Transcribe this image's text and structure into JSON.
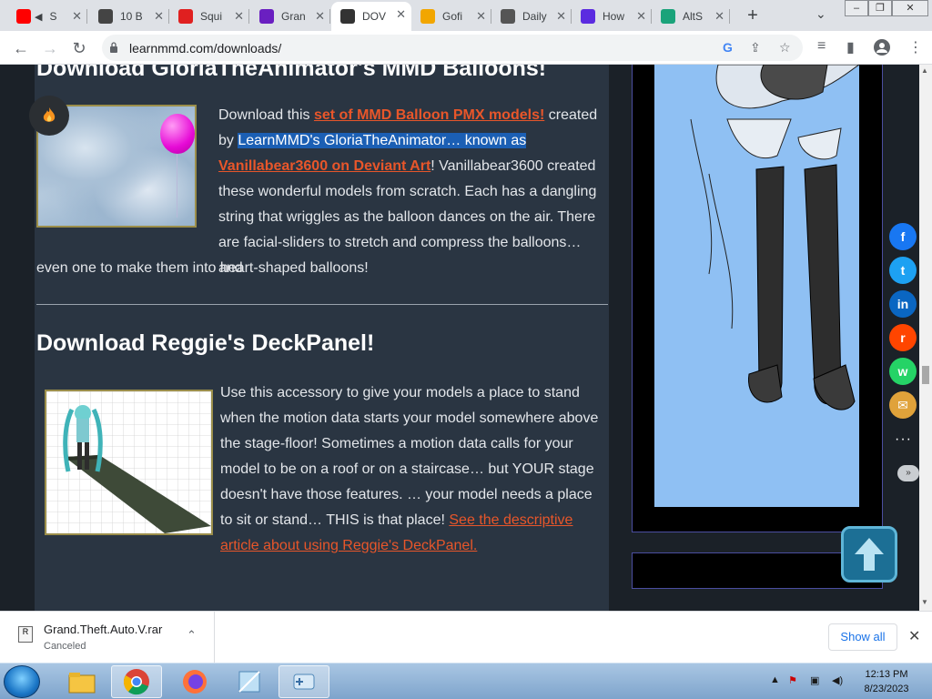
{
  "tabs": [
    {
      "title": "S",
      "favicon": "youtube-icon",
      "color": "#ff0000",
      "muted_icon": "speaker-icon"
    },
    {
      "title": "10 B",
      "favicon": "roblox-icon",
      "color": "#444444"
    },
    {
      "title": "Squi",
      "favicon": "lock-shield-icon",
      "color": "#e02020"
    },
    {
      "title": "Gran",
      "favicon": "rockstar-icon",
      "color": "#6a1fc1"
    },
    {
      "title": "DOV",
      "favicon": "mmd-icon",
      "color": "#333333",
      "active": true
    },
    {
      "title": "Gofi",
      "favicon": "gofile-icon",
      "color": "#f2a600"
    },
    {
      "title": "Daily",
      "favicon": "camera-icon",
      "color": "#555555"
    },
    {
      "title": "How",
      "favicon": "delta-icon",
      "color": "#5b2be0"
    },
    {
      "title": "AltS",
      "favicon": "alts-icon",
      "color": "#1aa37a"
    }
  ],
  "toolbar": {
    "url": "learnmmd.com/downloads/"
  },
  "article": {
    "heading1": "Download GloriaTheAnimator's MMD Balloons!",
    "p1_before": "Download this ",
    "p1_link1": "set of MMD Balloon PMX models!",
    "p1_mid": " created by ",
    "p1_sel1": "LearnMMD's GloriaTheAnimator… known as",
    "p1_link2": "Vanillabear3600 on Deviant Art",
    "p1_rest": "! Vanillabear3600 created these wonderful models from scratch. Each has a dangling string that wriggles as the balloon dances on the air. There are facial-sliders to stretch and compress the balloons… and",
    "p1_last": "even one to make them into heart-shaped balloons!",
    "heading2": "Download Reggie's DeckPanel!",
    "p2_text": "Use this accessory to give your models a place to stand when the motion data starts your model somewhere above the stage-floor! Sometimes a motion data calls for your model to be on a roof or on a staircase… but YOUR stage doesn't have those features. … your model needs a place to sit or stand… THIS is that place! ",
    "p2_link": "See the descriptive article about using Reggie's DeckPanel."
  },
  "share": [
    {
      "name": "facebook-icon",
      "glyph": "f",
      "color": "#1877f2"
    },
    {
      "name": "twitter-icon",
      "glyph": "t",
      "color": "#1da1f2"
    },
    {
      "name": "linkedin-icon",
      "glyph": "in",
      "color": "#0a66c2"
    },
    {
      "name": "reddit-icon",
      "glyph": "r",
      "color": "#ff4500"
    },
    {
      "name": "whatsapp-icon",
      "glyph": "w",
      "color": "#25d366"
    },
    {
      "name": "email-icon",
      "glyph": "✉",
      "color": "#e0a23a"
    }
  ],
  "downloads": {
    "file_name": "Grand.Theft.Auto.V.rar",
    "status": "Canceled",
    "show_all": "Show all"
  },
  "taskbar": {
    "time": "12:13 PM",
    "date": "8/23/2023"
  }
}
